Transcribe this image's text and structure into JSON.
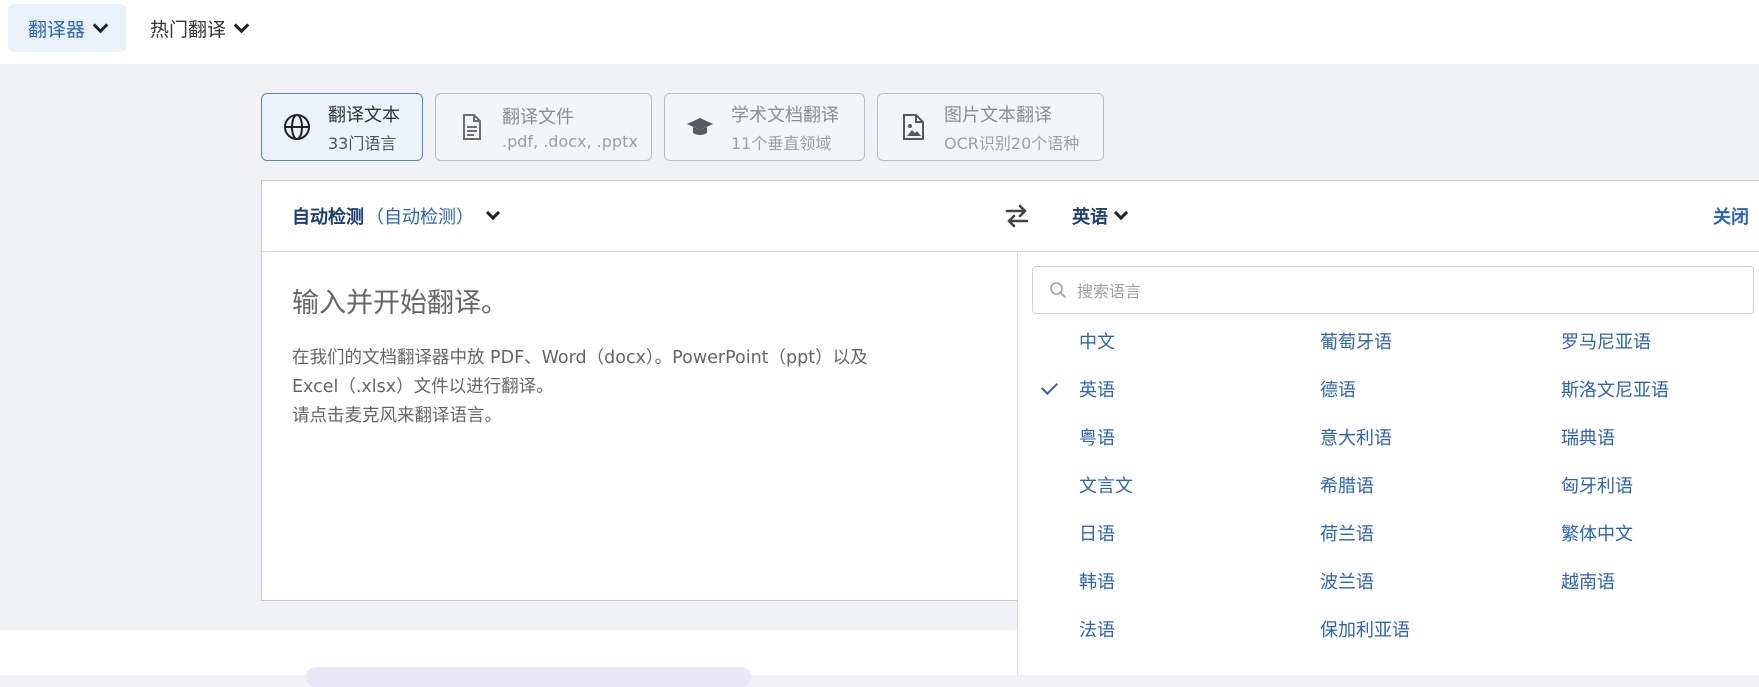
{
  "topnav": {
    "translator_label": "翻译器",
    "hot_label": "热门翻译"
  },
  "modes": [
    {
      "title": "翻译文本",
      "subtitle": "33门语言",
      "icon": "globe-icon",
      "active": true
    },
    {
      "title": "翻译文件",
      "subtitle": ".pdf, .docx, .pptx",
      "icon": "document-icon",
      "active": false
    },
    {
      "title": "学术文档翻译",
      "subtitle": "11个垂直领域",
      "icon": "graduation-cap-icon",
      "active": false
    },
    {
      "title": "图片文本翻译",
      "subtitle": "OCR识别20个语种",
      "icon": "image-file-icon",
      "active": false
    }
  ],
  "translator": {
    "source_lang": "自动检测",
    "source_lang_detail": "（自动检测）",
    "target_lang": "英语",
    "close_label": "关闭",
    "source_heading": "输入并开始翻译。",
    "source_hint_lines": [
      "在我们的文档翻译器中放 PDF、Word（docx）。PowerPoint（ppt）以及",
      "Excel（.xlsx）文件以进行翻译。",
      "请点击麦克风来翻译语言。"
    ]
  },
  "language_picker": {
    "search_placeholder": "搜索语言",
    "selected": "英语",
    "columns": [
      [
        "中文",
        "英语",
        "粤语",
        "文言文",
        "日语",
        "韩语",
        "法语"
      ],
      [
        "葡萄牙语",
        "德语",
        "意大利语",
        "希腊语",
        "荷兰语",
        "波兰语",
        "保加利亚语"
      ],
      [
        "罗马尼亚语",
        "斯洛文尼亚语",
        "瑞典语",
        "匈牙利语",
        "繁体中文",
        "越南语"
      ]
    ]
  },
  "colors": {
    "accent": "#2b64b8",
    "accent_dark": "#1f3f72",
    "page_bg": "#f0f2f5",
    "active_card_bg": "#eaf2fb"
  }
}
